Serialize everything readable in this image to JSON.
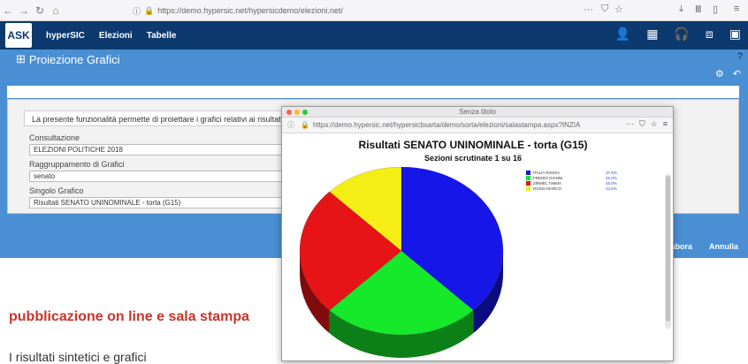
{
  "browser": {
    "url": "https://demo.hypersic.net/hypersicdemo/elezioni.net/",
    "url_host": "demo.hypersic.net"
  },
  "app": {
    "logo_text": "ASK",
    "menu": [
      "hyperSIC",
      "Elezioni",
      "Tabelle"
    ]
  },
  "page": {
    "title": "Proiezione Grafici",
    "info_text": "La presente funzionalità permette di proiettare i grafici relativi ai risultati e",
    "fields": [
      {
        "label": "Consultazione",
        "value": "ELEZIONI POLITICHE 2018"
      },
      {
        "label": "Raggruppamento di Grafici",
        "value": "senato"
      },
      {
        "label": "Singolo Grafico",
        "value": "Risultati SENATO UNINOMINALE - torta (G15)"
      }
    ],
    "buttons": {
      "elabora": "labora",
      "annulla": "Annulla"
    }
  },
  "article": {
    "title": "pubblicazione on line e sala stampa",
    "text": "I risultati sintetici e grafici"
  },
  "popup": {
    "window_title": "Senza titolo",
    "url": "https://demo.hypersic.net/hypersicbsarta/demo/sorta/elezioni/salastampa.aspx?INZIA",
    "url_host": "demo.hypersic.net"
  },
  "chart_data": {
    "type": "pie",
    "title": "Risultati SENATO UNINOMINALE - torta (G15)",
    "subtitle": "Sezioni scrutinate 1 su 16",
    "categories": [
      "ITALIA ROSSA",
      "FREDDI GIANNI",
      "ZIRMEL TIMMA",
      "ROSSI MARCO"
    ],
    "values": [
      37.5,
      25.0,
      25.0,
      12.5
    ],
    "labels": [
      "37.5%",
      "25.0%",
      "25.0%",
      "12.5%"
    ],
    "colors": [
      "#1616e8",
      "#16e82a",
      "#e61416",
      "#f5ee16"
    ],
    "legend_position": "top-right"
  }
}
